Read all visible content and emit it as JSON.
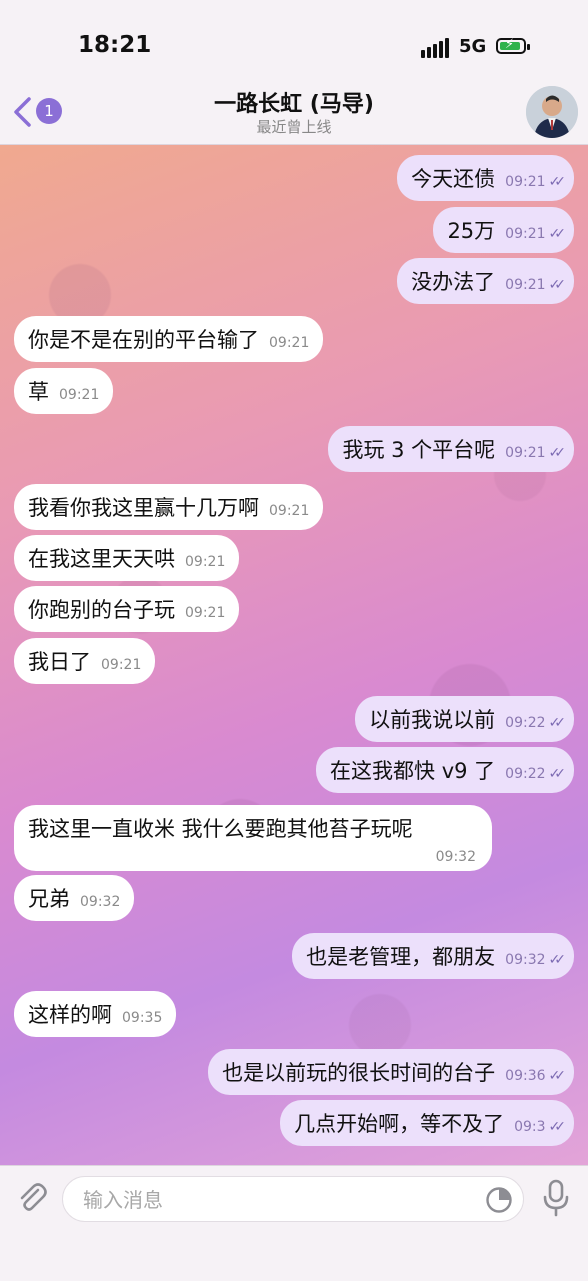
{
  "status_bar": {
    "time": "18:21",
    "network": "5G"
  },
  "header": {
    "back_badge": "1",
    "title": "一路长虹 (马导)",
    "subtitle": "最近曾上线"
  },
  "messages": [
    {
      "dir": "out",
      "text": "今天还债",
      "time": "09:21"
    },
    {
      "dir": "out",
      "text": "25万",
      "time": "09:21"
    },
    {
      "dir": "out",
      "text": "没办法了",
      "time": "09:21"
    },
    {
      "dir": "in",
      "text": "你是不是在别的平台输了",
      "time": "09:21"
    },
    {
      "dir": "in",
      "text": "草",
      "time": "09:21"
    },
    {
      "dir": "out",
      "text": "我玩 3 个平台呢",
      "time": "09:21"
    },
    {
      "dir": "in",
      "text": "我看你我这里赢十几万啊",
      "time": "09:21"
    },
    {
      "dir": "in",
      "text": "在我这里天天哄",
      "time": "09:21"
    },
    {
      "dir": "in",
      "text": "你跑别的台子玩",
      "time": "09:21"
    },
    {
      "dir": "in",
      "text": "我日了",
      "time": "09:21"
    },
    {
      "dir": "out",
      "text": "以前我说以前",
      "time": "09:22"
    },
    {
      "dir": "out",
      "text": "在这我都快 v9 了",
      "time": "09:22"
    },
    {
      "dir": "in",
      "text": "我这里一直收米 我什么要跑其他苔子玩呢",
      "time": "09:32"
    },
    {
      "dir": "in",
      "text": "兄弟",
      "time": "09:32"
    },
    {
      "dir": "out",
      "text": "也是老管理，都朋友",
      "time": "09:32"
    },
    {
      "dir": "in",
      "text": "这样的啊",
      "time": "09:35"
    },
    {
      "dir": "out",
      "text": "也是以前玩的很长时间的台子",
      "time": "09:36"
    },
    {
      "dir": "out",
      "text": "几点开始啊，等不及了",
      "time": "09:3"
    }
  ],
  "input": {
    "placeholder": "输入消息"
  },
  "colors": {
    "accent": "#8b6fd6",
    "out_bubble": "#ece0fb",
    "in_bubble": "#ffffff"
  }
}
